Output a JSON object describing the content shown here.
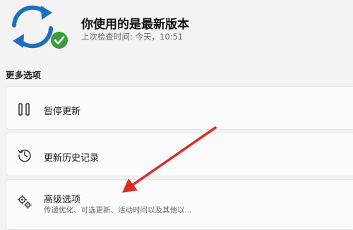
{
  "status": {
    "title": "你使用的是最新版本",
    "last_checked": "上次检查时间: 今天，10:51",
    "icon": "sync-check-icon",
    "accent": "#1d6fbd",
    "check_color": "#3c9b3c"
  },
  "more_options": {
    "heading": "更多选项",
    "items": [
      {
        "label": "暂停更新",
        "icon": "pause-icon"
      },
      {
        "label": "更新历史记录",
        "icon": "history-icon"
      },
      {
        "label": "高级选项",
        "icon": "gears-icon",
        "description": "传递优化、可选更新、活动时间以及其他以..."
      }
    ]
  },
  "annotation": {
    "arrow_color": "#e02b27"
  }
}
